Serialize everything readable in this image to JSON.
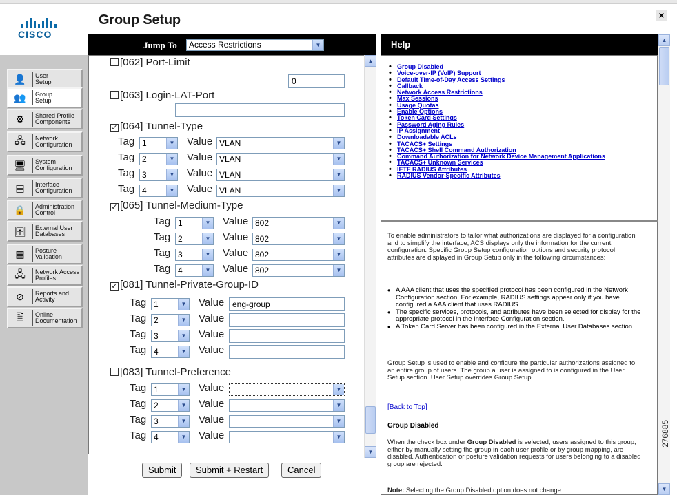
{
  "brand": {
    "logo_text": "CISCO"
  },
  "page": {
    "title": "Group Setup",
    "close_label": "×"
  },
  "nav": {
    "items": [
      {
        "label1": "User",
        "label2": "Setup",
        "icon": "user-setup-icon"
      },
      {
        "label1": "Group",
        "label2": "Setup",
        "icon": "group-setup-icon"
      },
      {
        "label1": "Shared Profile",
        "label2": "Components",
        "icon": "shared-profile-icon"
      },
      {
        "label1": "Network",
        "label2": "Configuration",
        "icon": "network-config-icon"
      },
      {
        "label1": "System",
        "label2": "Configuration",
        "icon": "system-config-icon"
      },
      {
        "label1": "Interface",
        "label2": "Configuration",
        "icon": "interface-config-icon"
      },
      {
        "label1": "Administration",
        "label2": "Control",
        "icon": "admin-control-icon"
      },
      {
        "label1": "External User",
        "label2": "Databases",
        "icon": "external-db-icon"
      },
      {
        "label1": "Posture",
        "label2": "Validation",
        "icon": "posture-icon"
      },
      {
        "label1": "Network Access",
        "label2": "Profiles",
        "icon": "network-access-icon"
      },
      {
        "label1": "Reports and",
        "label2": "Activity",
        "icon": "reports-icon"
      },
      {
        "label1": "Online",
        "label2": "Documentation",
        "icon": "documentation-icon"
      }
    ]
  },
  "jump": {
    "label": "Jump To",
    "selected": "Access Restrictions"
  },
  "form": {
    "port_limit": {
      "label": "[062] Port-Limit",
      "value": "0"
    },
    "login_lat": {
      "label": "[063] Login-LAT-Port",
      "value": ""
    },
    "tunnel_type": {
      "label": "[064] Tunnel-Type",
      "rows": [
        {
          "tag": "1",
          "value": "VLAN"
        },
        {
          "tag": "2",
          "value": "VLAN"
        },
        {
          "tag": "3",
          "value": "VLAN"
        },
        {
          "tag": "4",
          "value": "VLAN"
        }
      ]
    },
    "tunnel_medium": {
      "label": "[065] Tunnel-Medium-Type",
      "rows": [
        {
          "tag": "1",
          "value": "802"
        },
        {
          "tag": "2",
          "value": "802"
        },
        {
          "tag": "3",
          "value": "802"
        },
        {
          "tag": "4",
          "value": "802"
        }
      ]
    },
    "tunnel_group": {
      "label": "[081] Tunnel-Private-Group-ID",
      "rows": [
        {
          "tag": "1",
          "value": "eng-group"
        },
        {
          "tag": "2",
          "value": ""
        },
        {
          "tag": "3",
          "value": ""
        },
        {
          "tag": "4",
          "value": ""
        }
      ]
    },
    "tunnel_pref": {
      "label": "[083] Tunnel-Preference",
      "rows": [
        {
          "tag": "1",
          "value": ""
        },
        {
          "tag": "2",
          "value": ""
        },
        {
          "tag": "3",
          "value": ""
        },
        {
          "tag": "4",
          "value": ""
        }
      ]
    },
    "tag_label": "Tag",
    "value_label": "Value"
  },
  "buttons": {
    "submit": "Submit",
    "submit_restart": "Submit + Restart",
    "cancel": "Cancel"
  },
  "help": {
    "title": "Help",
    "links": [
      "Group Disabled",
      "Voice-over-IP (VoIP) Support",
      "Default Time-of-Day Access Settings",
      "Callback",
      "Network Access Restrictions",
      "Max Sessions",
      "Usage Quotas",
      "Enable Options",
      "Token Card Settings",
      "Password Aging Rules",
      "IP Assignment",
      "Downloadable ACLs",
      "TACACS+ Settings",
      "TACACS+ Shell Command Authorization",
      "Command Authorization for Network Device Management Applications",
      "TACACS+ Unknown Services",
      "IETF RADIUS Attributes",
      "RADIUS Vendor-Specific Attributes"
    ],
    "intro": "To enable administrators to tailor what authorizations are displayed for a configuration and to simplify the interface, ACS displays only the information for the current configuration. Specific Group Setup configuration options and security protocol attributes are displayed in Group Setup only in the following circumstances:",
    "bullets": [
      "A AAA client that uses the specified protocol has been configured in the Network Configuration section. For example, RADIUS settings appear only if you have configured a AAA client that uses RADIUS.",
      "The specific services, protocols, and attributes have been selected for display for the appropriate protocol in the Interface Configuration section.",
      "A Token Card Server has been configured in the External User Databases section."
    ],
    "para2": "Group Setup is used to enable and configure the particular authorizations assigned to an entire group of users. The group a user is assigned to is configured in the User Setup section. User Setup overrides Group Setup.",
    "back_to_top": "[Back to Top]",
    "section_heading": "Group Disabled",
    "para3_pre": "When the check box under ",
    "para3_bold": "Group Disabled",
    "para3_post": " is selected, users assigned to this group, either by manually setting the group in each user profile or by group mapping, are disabled. Authentication or posture validation requests for users belonging to a disabled group are rejected.",
    "note_bold": "Note:",
    "note_text": " Selecting the Group Disabled option does not change"
  },
  "figure_number": "276885"
}
